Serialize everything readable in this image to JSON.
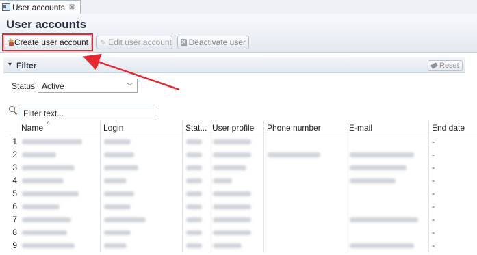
{
  "tab": {
    "label": "User accounts",
    "close": "⊠"
  },
  "page": {
    "title": "User accounts"
  },
  "toolbar": {
    "create_label": "Create user account",
    "edit_label": "Edit user account",
    "deactivate_label": "Deactivate user"
  },
  "filter": {
    "title": "Filter",
    "toggle": "▾",
    "reset_label": "Reset",
    "status_label": "Status",
    "status_value": "Active",
    "search_placeholder": "Filter text..."
  },
  "table": {
    "sort_indicator": "^",
    "columns": [
      "Name",
      "Login",
      "Stat...",
      "User profile",
      "Phone number",
      "E-mail",
      "End date"
    ],
    "rows": [
      {
        "num": "1",
        "end_date": "-"
      },
      {
        "num": "2",
        "end_date": "-"
      },
      {
        "num": "3",
        "end_date": "-"
      },
      {
        "num": "4",
        "end_date": "-"
      },
      {
        "num": "5",
        "end_date": "-"
      },
      {
        "num": "6",
        "end_date": "-"
      },
      {
        "num": "7",
        "end_date": "-"
      },
      {
        "num": "8",
        "end_date": "-"
      },
      {
        "num": "9",
        "end_date": "-"
      }
    ]
  },
  "colors": {
    "highlight": "#e8262d",
    "arrow": "#e8262d"
  }
}
